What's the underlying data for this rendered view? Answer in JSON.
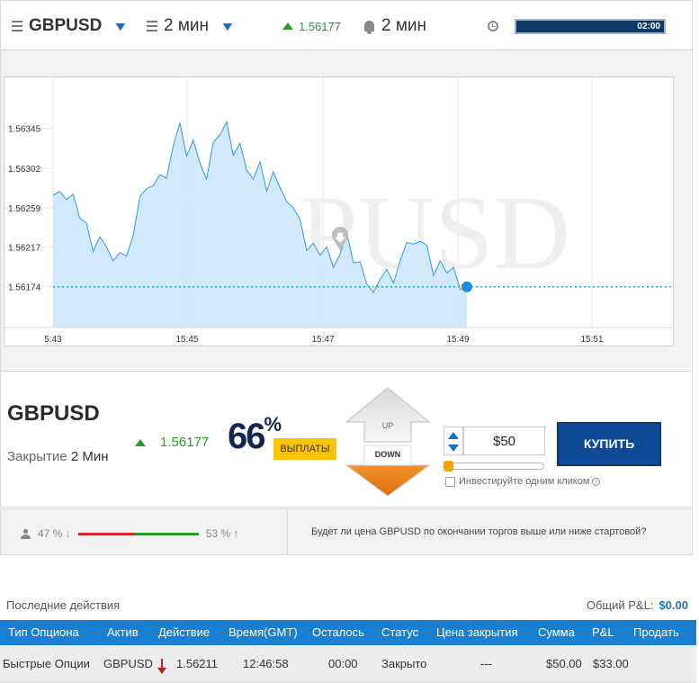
{
  "topbar": {
    "asset": "GBPUSD",
    "timeframe": "2 мин",
    "price": "1.56177",
    "alert_timeframe": "2 мин",
    "timer": "02:00",
    "icons": [
      "list-icon",
      "chevron-down-icon",
      "up-arrow-icon",
      "bell-icon",
      "clock-icon"
    ]
  },
  "chart_data": {
    "type": "area",
    "watermark": "GBPUSD",
    "y_ticks": [
      "1.56345",
      "1.56302",
      "1.56259",
      "1.56217",
      "1.56174"
    ],
    "x_ticks": [
      "5:43",
      "15:45",
      "15:47",
      "15:49",
      "15:51"
    ],
    "ylim": [
      1.5613,
      1.564
    ],
    "current_price": 1.56174,
    "x": [
      0,
      1,
      2,
      3,
      4,
      5,
      6,
      7,
      8,
      9,
      10,
      11,
      12,
      13,
      14,
      15,
      16,
      17,
      18,
      19,
      20,
      21,
      22,
      23,
      24,
      25,
      26,
      27,
      28,
      29,
      30,
      31,
      32,
      33,
      34,
      35,
      36,
      37,
      38,
      39,
      40,
      41,
      42,
      43,
      44,
      45,
      46,
      47,
      48,
      49,
      50,
      51,
      52,
      53,
      54,
      55,
      56,
      57,
      58,
      59,
      60,
      61,
      62
    ],
    "values": [
      1.56273,
      1.56277,
      1.56268,
      1.56274,
      1.56248,
      1.56243,
      1.56212,
      1.56228,
      1.56217,
      1.56202,
      1.56211,
      1.56207,
      1.56229,
      1.56271,
      1.5628,
      1.56283,
      1.56295,
      1.56291,
      1.56326,
      1.56351,
      1.56315,
      1.56332,
      1.56308,
      1.5629,
      1.5633,
      1.56338,
      1.56352,
      1.56316,
      1.56329,
      1.563,
      1.5629,
      1.56309,
      1.56277,
      1.56298,
      1.56281,
      1.56266,
      1.56259,
      1.56247,
      1.56213,
      1.56221,
      1.56208,
      1.56217,
      1.56195,
      1.56209,
      1.56232,
      1.562,
      1.56201,
      1.56177,
      1.56168,
      1.56182,
      1.56193,
      1.56178,
      1.56202,
      1.56222,
      1.5622,
      1.56223,
      1.56219,
      1.56186,
      1.56202,
      1.56189,
      1.56195,
      1.56171,
      1.56174
    ]
  },
  "trade": {
    "asset": "GBPUSD",
    "close_label": "Закрытие",
    "close_value": "2 Мин",
    "price": "1.56177",
    "payout_pct": "66",
    "payout_sign": "%",
    "payout_label": "ВЫПЛАТЫ",
    "up_label": "UP",
    "down_label": "DOWN",
    "amount": "$50",
    "one_click_label": "Инвестируйте одним кликом",
    "buy_label": "КУПИТЬ"
  },
  "sentiment": {
    "down_pct": "47 % ↓",
    "up_pct": "53 % ↑",
    "question": "Будет ли цена GBPUSD по окончании торгов выше или ниже стартовой?",
    "down_color": "#d6262b",
    "up_color": "#2a9a2a"
  },
  "recent": {
    "title": "Последние действия",
    "pnl_label": "Общий P&L:",
    "pnl_value": "$0.00",
    "columns": [
      "Тип Опциона",
      "Актив",
      "Действие",
      "Время(GMT)",
      "Осталось",
      "Статус",
      "Цена закрытия",
      "Сумма",
      "P&L",
      "Продать"
    ],
    "rows": [
      {
        "type": "Быстрые Опции",
        "asset": "GBPUSD",
        "action_price": "1.56211",
        "time": "12:46:58",
        "remaining": "00:00",
        "status": "Закрыто",
        "close_price": "---",
        "amount": "$50.00",
        "pnl": "$33.00"
      }
    ]
  },
  "colors": {
    "accent": "#1a7fd1",
    "buy": "#0e4a95",
    "payout": "#f9c307",
    "positive": "#2a9a2a",
    "chart_fill": "#cfe8fb",
    "chart_line": "#2d9ae0"
  }
}
